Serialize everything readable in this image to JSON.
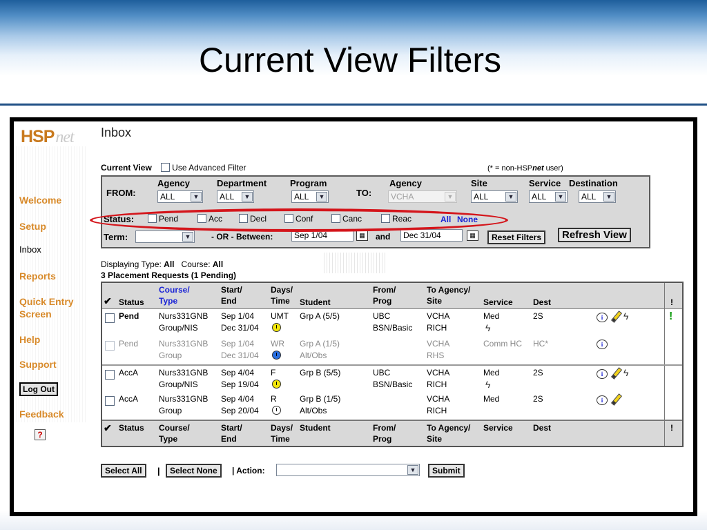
{
  "slide": {
    "title": "Current View Filters"
  },
  "nav": {
    "logo_text": "HSP",
    "logo_suffix": "net",
    "items": [
      "Welcome",
      "Setup",
      "Inbox",
      "Reports",
      "Quick Entry Screen",
      "Help",
      "Support"
    ],
    "logout": "Log Out",
    "feedback": "Feedback",
    "help_icon": "question-book-icon"
  },
  "page": {
    "title": "Inbox",
    "current_view": "Current View",
    "advanced_filter": "Use Advanced Filter",
    "non_user_note_prefix": "(* = non-HSP",
    "non_user_note_net": "net",
    "non_user_note_suffix": " user)"
  },
  "filters": {
    "from_label": "FROM:",
    "to_label": "TO:",
    "headers": {
      "agency": "Agency",
      "department": "Department",
      "program": "Program",
      "to_agency": "Agency",
      "site": "Site",
      "service": "Service",
      "destination": "Destination"
    },
    "values": {
      "agency": "ALL",
      "department": "ALL",
      "program": "ALL",
      "to_agency": "VCHA",
      "site": "ALL",
      "service": "ALL",
      "destination": "ALL"
    },
    "status_label": "Status:",
    "statuses": [
      "Pend",
      "Acc",
      "Decl",
      "Conf",
      "Canc",
      "Reac"
    ],
    "all_link": "All",
    "none_link": "None",
    "term_label": "Term:",
    "or_between": "- OR -  Between:",
    "start_date": "Sep 1/04",
    "and_label": "and",
    "end_date": "Dec 31/04",
    "reset_button": "Reset Filters",
    "refresh_button": "Refresh View"
  },
  "display": {
    "type_label": "Displaying Type: ",
    "type_value": "All",
    "course_label": "Course: ",
    "course_value": "All",
    "summary": "3 Placement Requests (1 Pending)"
  },
  "table": {
    "headers": {
      "check": "✔",
      "status": "Status",
      "course_1": "Course/",
      "course_2": "Type",
      "start_1": "Start/",
      "start_2": "End",
      "days_1": "Days/",
      "days_2": "Time",
      "student": "Student",
      "from_1": "From/",
      "from_2": "Prog",
      "to_1": "To Agency/",
      "to_2": "Site",
      "service": "Service",
      "dest": "Dest",
      "bang": "!"
    },
    "rows": [
      {
        "status": "Pend",
        "course": "Nurs331GNB",
        "type": "Group/NIS",
        "start": "Sep 1/04",
        "end": "Dec 31/04",
        "days": "UMT",
        "student": "Grp A (5/5)",
        "from": "UBC",
        "prog": "BSN/Basic",
        "to": "VCHA",
        "site": "RICH",
        "service": "Med",
        "dest": "2S",
        "clock": "yellow"
      },
      {
        "status": "Pend",
        "course": "Nurs331GNB",
        "type": "Group",
        "start": "Sep 1/04",
        "end": "Dec 31/04",
        "days": "WR",
        "student": "Grp A (1/5)",
        "student2": "Alt/Obs",
        "to": "VCHA",
        "site": "RHS",
        "service": "Comm HC",
        "dest": "HC*",
        "clock": "blue"
      },
      {
        "status": "AccA",
        "course": "Nurs331GNB",
        "type": "Group/NIS",
        "start": "Sep 4/04",
        "end": "Sep 19/04",
        "days": "F",
        "student": "Grp B (5/5)",
        "from": "UBC",
        "prog": "BSN/Basic",
        "to": "VCHA",
        "site": "RICH",
        "service": "Med",
        "dest": "2S",
        "clock": "yellow"
      },
      {
        "status": "AccA",
        "course": "Nurs331GNB",
        "type": "Group",
        "start": "Sep 4/04",
        "end": "Sep 20/04",
        "days": "R",
        "student": "Grp B (1/5)",
        "student2": "Alt/Obs",
        "to": "VCHA",
        "site": "RICH",
        "service": "Med",
        "dest": "2S",
        "clock": "white"
      }
    ],
    "bang_mark": "!"
  },
  "actions": {
    "select_all": "Select All",
    "select_none": "Select None",
    "separator": "|",
    "action_label": "| Action:",
    "submit": "Submit"
  },
  "colors": {
    "accent_orange": "#d88a2a",
    "link_blue": "#1a23d6",
    "highlight_red": "#d4151b",
    "frame_gray": "#d9d9d9"
  }
}
